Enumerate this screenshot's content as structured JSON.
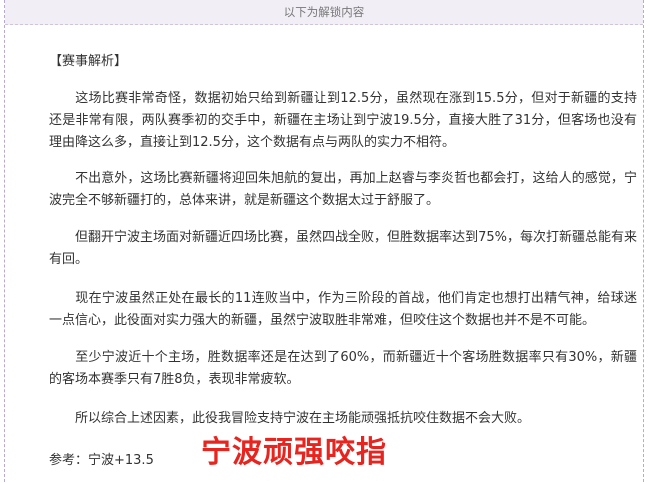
{
  "unlock_bar": {
    "text": "以下为解锁内容"
  },
  "article": {
    "section_title": "【赛事解析】",
    "paragraphs": [
      "这场比赛非常奇怪，数据初始只给到新疆让到12.5分，虽然现在涨到15.5分，但对于新疆的支持还是非常有限，两队赛季初的交手中，新疆在主场让到宁波19.5分，直接大胜了31分，但客场也没有理由降这么多，直接让到12.5分，这个数据有点与两队的实力不相符。",
      "不出意外，这场比赛新疆将迎回朱旭航的复出，再加上赵睿与李炎哲也都会打，这给人的感觉，宁波完全不够新疆打的，总体来讲，就是新疆这个数据太过于舒服了。",
      "但翻开宁波主场面对新疆近四场比赛，虽然四战全败，但胜数据率达到75%，每次打新疆总能有来有回。",
      "现在宁波虽然正处在最长的11连败当中，作为三阶段的首战，他们肯定也想打出精气神，给球迷一点信心，此役面对实力强大的新疆，虽然宁波取胜非常难，但咬住这个数据也并不是不可能。",
      "至少宁波近十个主场，胜数据率还是在达到了60%，而新疆近十个客场胜数据率只有30%，新疆的客场本赛季只有7胜8负，表现非常疲软。",
      "所以综合上述因素，此役我冒险支持宁波在主场能顽强抵抗咬住数据不会大败。"
    ],
    "reference": "参考：宁波+13.5",
    "stamp": "宁波顽强咬指",
    "stamp_color": "#e8241f"
  }
}
